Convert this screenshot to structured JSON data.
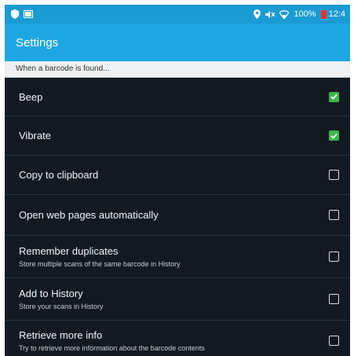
{
  "status_bar": {
    "battery_text": "100%",
    "time_text": "12:4"
  },
  "action_bar": {
    "title": "Settings"
  },
  "section": {
    "header": "When a barcode is found..."
  },
  "settings": [
    {
      "title": "Beep",
      "summary": "",
      "checked": true
    },
    {
      "title": "Vibrate",
      "summary": "",
      "checked": true
    },
    {
      "title": "Copy to clipboard",
      "summary": "",
      "checked": false
    },
    {
      "title": "Open web pages automatically",
      "summary": "",
      "checked": false
    },
    {
      "title": "Remember duplicates",
      "summary": "Store multiple scans of the same barcode in History",
      "checked": false
    },
    {
      "title": "Add to History",
      "summary": "Store your scans in History",
      "checked": false
    },
    {
      "title": "Retrieve more info",
      "summary": "Try to retrieve more information about the barcode contents",
      "checked": false
    }
  ],
  "colors": {
    "status_bar": "#1a9bd4",
    "action_bar": "#1ea6e2",
    "checkbox_checked": "#3cb648"
  }
}
